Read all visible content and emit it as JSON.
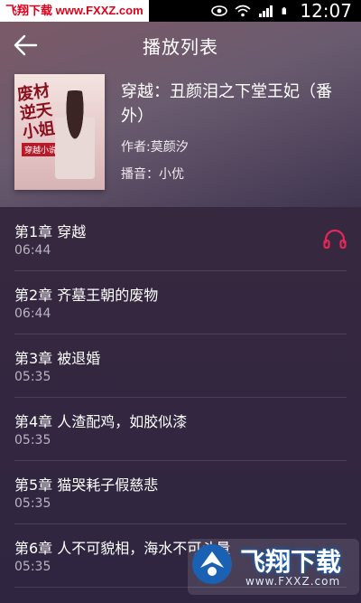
{
  "status_bar": {
    "watermark": "飞翔下载 www.FXXZ.com",
    "time": "12:07"
  },
  "header": {
    "title": "播放列表"
  },
  "book": {
    "cover_title": "废材逆天小姐",
    "cover_tag": "穿越小说",
    "title": "穿越：丑颜泪之下堂王妃（番外）",
    "author": "作者:莫颜汐",
    "narrator": "播音：小优"
  },
  "chapters": [
    {
      "title": "第1章   穿越",
      "duration": "06:44",
      "playing": true
    },
    {
      "title": "第2章   齐墓王朝的废物",
      "duration": "06:44",
      "playing": false
    },
    {
      "title": "第3章   被退婚",
      "duration": "05:35",
      "playing": false
    },
    {
      "title": "第4章   人渣配鸡，如胶似漆",
      "duration": "05:35",
      "playing": false
    },
    {
      "title": "第5章   猫哭耗子假慈悲",
      "duration": "05:35",
      "playing": false
    },
    {
      "title": "第6章   人不可貌相，海水不可斗量",
      "duration": "05:35",
      "playing": false
    }
  ],
  "watermark_corner": {
    "brand": "飞翔下载",
    "url": "www.FXXZ.com"
  },
  "colors": {
    "accent": "#e0285a",
    "list_bg": "#2f2540",
    "header_bg": "#6a5b6f"
  }
}
